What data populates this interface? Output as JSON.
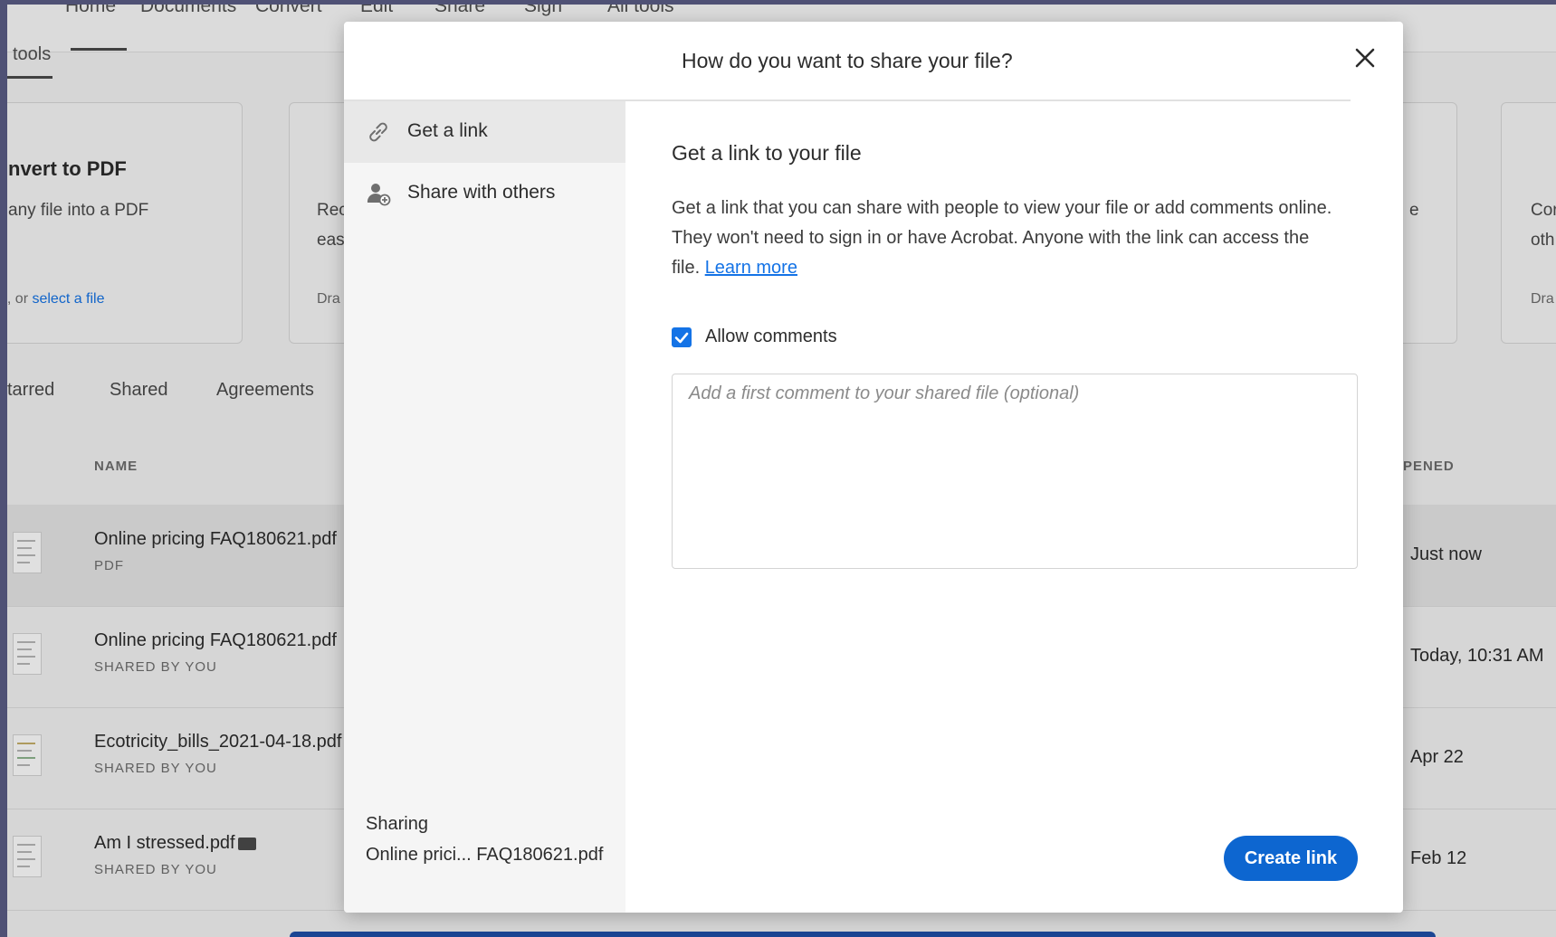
{
  "nav": {
    "items": [
      "Home",
      "Documents",
      "Convert",
      "Edit",
      "Share",
      "Sign",
      "All tools"
    ],
    "tools_tab": "tools"
  },
  "cards": {
    "convert": {
      "title": "nvert to PDF",
      "desc": "any file into a PDF",
      "link_prefix": "o, or ",
      "link": "select a file"
    },
    "second": {
      "desc1": "Rec",
      "desc2": "eas",
      "drop": "Dra"
    },
    "right1": {
      "desc": "e"
    },
    "right2": {
      "desc1": "Cor",
      "desc2": "oth",
      "drop": "Dra"
    }
  },
  "tabs": [
    "tarred",
    "Shared",
    "Agreements"
  ],
  "columns": {
    "name": "NAME",
    "opened": "PENED"
  },
  "files": [
    {
      "name": "Online pricing FAQ180621.pdf",
      "sub": "PDF",
      "date": "Just now"
    },
    {
      "name": "Online pricing FAQ180621.pdf",
      "sub": "SHARED BY YOU",
      "date": "Today, 10:31 AM"
    },
    {
      "name": "Ecotricity_bills_2021-04-18.pdf",
      "sub": "SHARED BY YOU",
      "date": "Apr 22"
    },
    {
      "name": "Am I stressed.pdf",
      "sub": "SHARED BY YOU",
      "date": "Feb 12"
    }
  ],
  "dialog": {
    "title": "How do you want to share your file?",
    "close_icon": "close-icon",
    "sidebar": {
      "items": [
        {
          "label": "Get a link",
          "icon": "link-icon"
        },
        {
          "label": "Share with others",
          "icon": "add-person-icon"
        }
      ],
      "sharing_label": "Sharing",
      "sharing_file": "Online prici... FAQ180621.pdf"
    },
    "content": {
      "title": "Get a link to your file",
      "desc": "Get a link that you can share with people to view your file or add comments online. They won't need to sign in or have Acrobat. Anyone with the link can access the file.",
      "learn_more": "Learn more",
      "allow_comments": "Allow comments",
      "comment_placeholder": "Add a first comment to your shared file (optional)",
      "create_link": "Create link"
    }
  },
  "colors": {
    "accent": "#0d66d0",
    "link": "#1473e6"
  }
}
